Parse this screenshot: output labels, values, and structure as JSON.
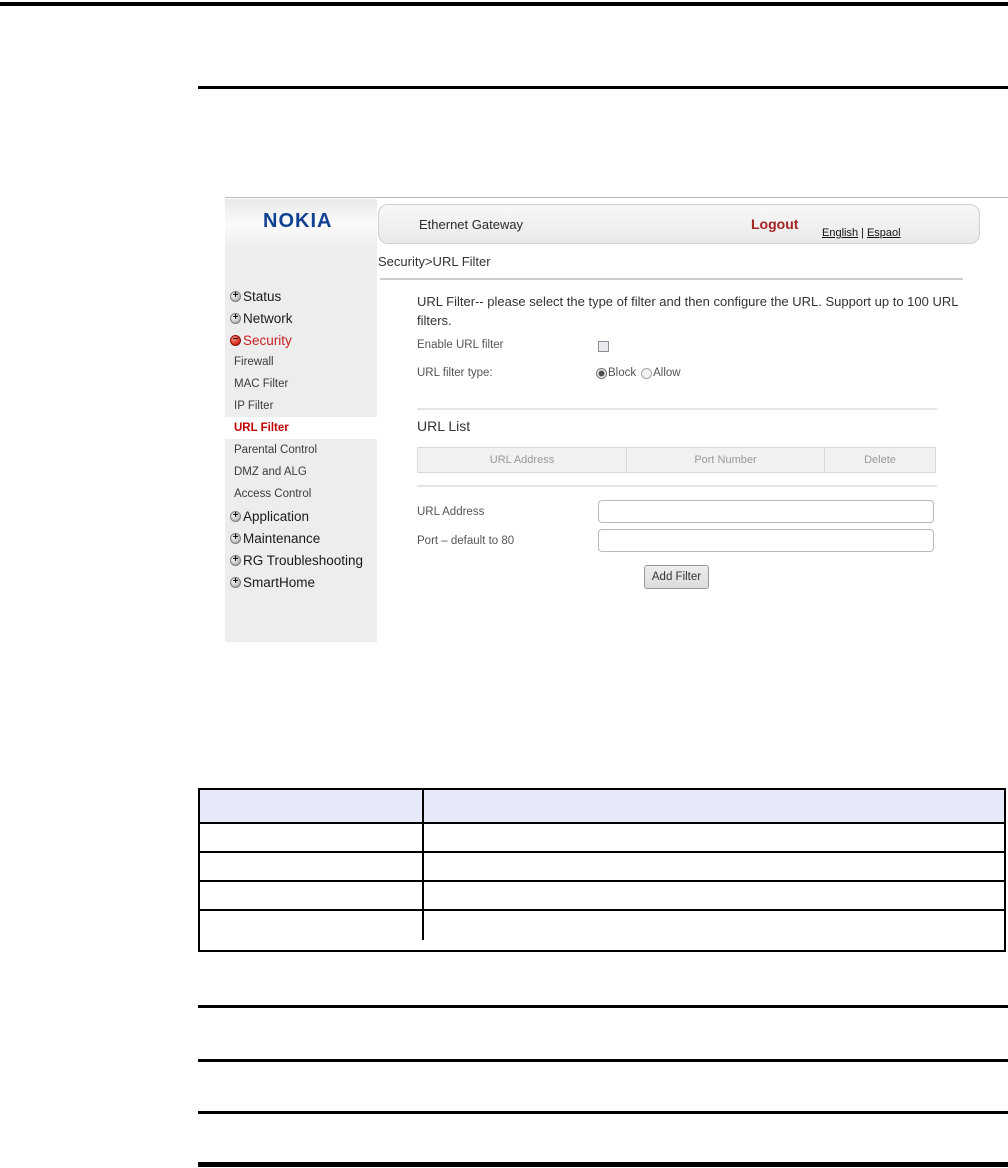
{
  "gateway": {
    "logo_text": "NOKIA",
    "header": {
      "title": "Ethernet Gateway",
      "logout_label": "Logout",
      "lang_english": "English",
      "lang_separator": "|",
      "lang_spanish": "Espaol"
    },
    "breadcrumb": "Security>URL Filter",
    "sidebar": {
      "items": [
        {
          "label": "Status",
          "icon": "plus-circle",
          "level": "top"
        },
        {
          "label": "Network",
          "icon": "plus-circle",
          "level": "top"
        },
        {
          "label": "Security",
          "icon": "minus-circle",
          "level": "top",
          "expanded": true,
          "highlight": "red"
        },
        {
          "label": "Firewall",
          "level": "sub"
        },
        {
          "label": "MAC Filter",
          "level": "sub"
        },
        {
          "label": "IP Filter",
          "level": "sub"
        },
        {
          "label": "URL Filter",
          "level": "sub",
          "selected": true
        },
        {
          "label": "Parental Control",
          "level": "sub"
        },
        {
          "label": "DMZ and ALG",
          "level": "sub"
        },
        {
          "label": "Access Control",
          "level": "sub"
        },
        {
          "label": "Application",
          "icon": "plus-circle",
          "level": "top"
        },
        {
          "label": "Maintenance",
          "icon": "plus-circle",
          "level": "top"
        },
        {
          "label": "RG Troubleshooting",
          "icon": "plus-circle",
          "level": "top"
        },
        {
          "label": "SmartHome",
          "icon": "plus-circle",
          "level": "top"
        }
      ]
    },
    "content": {
      "description": "URL Filter-- please select the type of filter and then configure the URL. Support up to 100 URL filters.",
      "enable_label": "Enable URL filter",
      "enable_checked": false,
      "type_label": "URL filter type:",
      "type_selected": "Block",
      "radio_block_label": "Block",
      "radio_allow_label": "Allow",
      "url_list_title": "URL List",
      "table_headers": [
        "URL Address",
        "Port Number",
        "Delete"
      ],
      "url_address_label": "URL Address",
      "url_address_value": "",
      "port_label": "Port – default to 80",
      "port_value": "",
      "add_button_label": "Add Filter"
    }
  },
  "doc_table": {
    "columns": 2,
    "body_rows": 4,
    "header_fill": "#e6eaf8",
    "cells_empty": true
  },
  "colors": {
    "nav_accent_red": "#c00000",
    "logo_blue": "#124191",
    "logout_red": "#a32222",
    "doc_table_header_fill": "#e6eaf8"
  }
}
